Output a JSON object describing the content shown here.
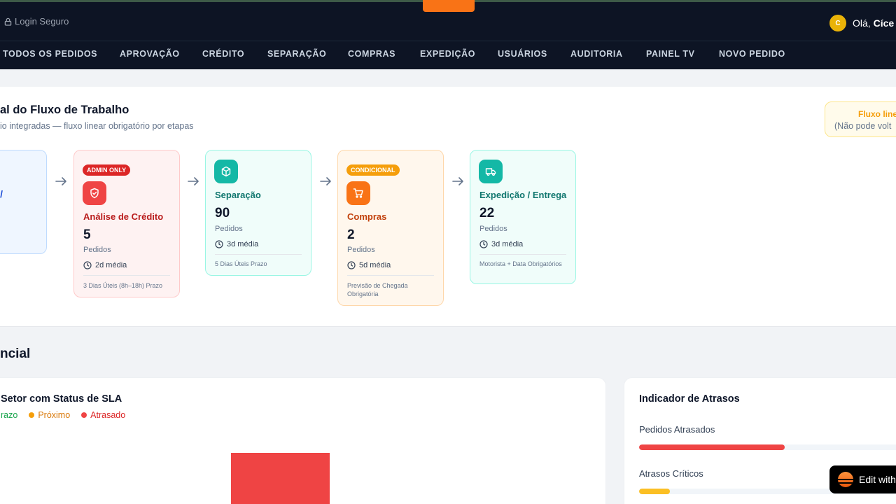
{
  "header": {
    "login_secure": "Login Seguro",
    "avatar_initial": "C",
    "greeting": "Olá,",
    "user_name": "Cíce"
  },
  "nav": {
    "items": [
      {
        "label": "TODOS OS PEDIDOS"
      },
      {
        "label": "APROVAÇÃO"
      },
      {
        "label": "CRÉDITO"
      },
      {
        "label": "SEPARAÇÃO"
      },
      {
        "label": "COMPRAS"
      },
      {
        "label": "EXPEDIÇÃO"
      },
      {
        "label": "USUÁRIOS"
      },
      {
        "label": "AUDITORIA"
      },
      {
        "label": "PAINEL TV"
      },
      {
        "label": "NOVO PEDIDO"
      }
    ]
  },
  "workflow": {
    "title": "al do Fluxo de Trabalho",
    "subtitle": "io integradas — fluxo linear obrigatório por etapas",
    "linear_notice": {
      "title": "Fluxo line",
      "subtitle": "(Não pode volt"
    },
    "first_card_text": "/",
    "stages": [
      {
        "badge": "ADMIN ONLY",
        "icon": "shield-icon",
        "name": "Análise de Crédito",
        "count": "5",
        "unit": "Pedidos",
        "avg": "2d média",
        "note": "3 Dias Úteis (8h–18h) Prazo",
        "color": "#b91c1c"
      },
      {
        "icon": "box-icon",
        "name": "Separação",
        "count": "90",
        "unit": "Pedidos",
        "avg": "3d média",
        "note": "5 Dias Úteis Prazo",
        "color": "#0f766e"
      },
      {
        "badge": "CONDICIONAL",
        "icon": "cart-icon",
        "name": "Compras",
        "count": "2",
        "unit": "Pedidos",
        "avg": "5d média",
        "note": "Previsão de Chegada Obrigatória",
        "color": "#c2410c"
      },
      {
        "icon": "truck-icon",
        "name": "Expedição / Entrega",
        "count": "22",
        "unit": "Pedidos",
        "avg": "3d média",
        "note": "Motorista + Data Obrigatórios",
        "color": "#0f766e"
      }
    ]
  },
  "section2": {
    "title": "ncial",
    "sla_panel": {
      "title": "Setor com Status de SLA",
      "legend": [
        {
          "label": "razo",
          "color": "#16a34a"
        },
        {
          "label": "Próximo",
          "color": "#f59e0b"
        },
        {
          "label": "Atrasado",
          "color": "#ef4444"
        }
      ]
    },
    "delay_panel": {
      "title": "Indicador de Atrasos",
      "metrics": [
        {
          "label": "Pedidos Atrasados",
          "fill_fraction": 0.52,
          "color": "#ef4444"
        },
        {
          "label": "Atrasos Críticos",
          "fill_fraction": 0.11,
          "color": "#fbbf24"
        }
      ]
    }
  },
  "edit_badge": {
    "label": "Edit with"
  }
}
